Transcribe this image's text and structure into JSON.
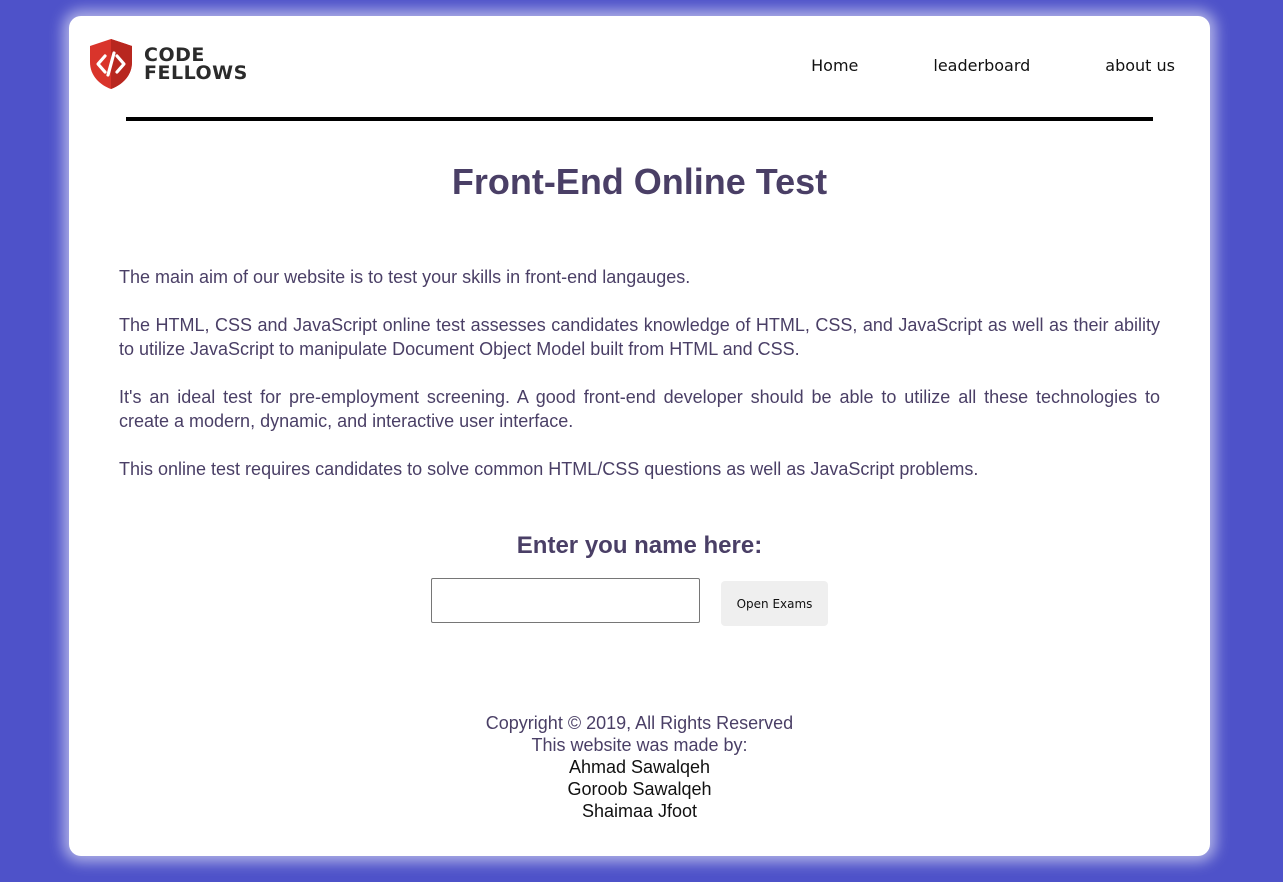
{
  "header": {
    "logo_line1": "CODE",
    "logo_line2": "FELLOWS",
    "nav": [
      {
        "label": "Home"
      },
      {
        "label": "leaderboard"
      },
      {
        "label": "about us"
      }
    ]
  },
  "main": {
    "title": "Front-End Online Test",
    "paragraphs": [
      "The main aim of our website is to test your skills in front-end langauges.",
      "The HTML, CSS and JavaScript online test assesses candidates knowledge of HTML, CSS, and JavaScript as well as their ability to utilize JavaScript to manipulate Document Object Model built from HTML and CSS.",
      "It's an ideal test for pre-employment screening. A good front-end developer should be able to utilize all these technologies to create a modern, dynamic, and interactive user interface.",
      "This online test requires candidates to solve common HTML/CSS questions as well as JavaScript problems."
    ],
    "name_heading": "Enter you name here:",
    "name_input_value": "",
    "open_button": "Open Exams"
  },
  "footer": {
    "copyright": "Copyright © 2019, All Rights Reserved",
    "made_by": "This website was made by:",
    "authors": [
      "Ahmad Sawalqeh",
      "Goroob Sawalqeh",
      "Shaimaa Jfoot"
    ]
  },
  "colors": {
    "background": "#4e52c9",
    "heading": "#4a3f66",
    "logo_shield": "#d9342b"
  },
  "icons": {
    "logo": "code-shield-icon"
  }
}
